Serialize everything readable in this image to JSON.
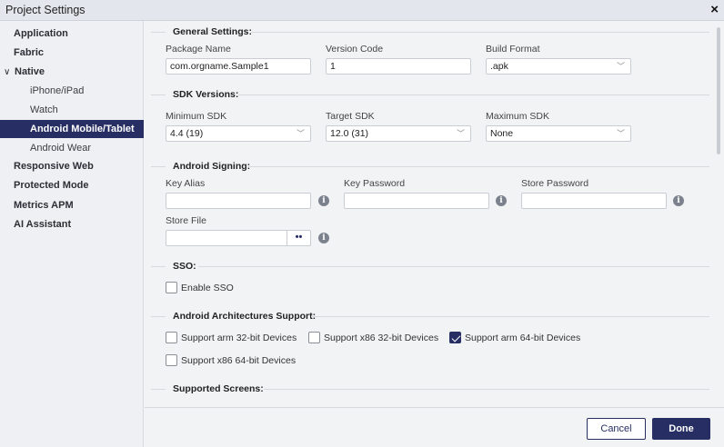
{
  "window": {
    "title": "Project Settings",
    "close_icon": "×"
  },
  "sidebar": {
    "items": [
      {
        "label": "Application"
      },
      {
        "label": "Fabric"
      },
      {
        "label": "Native",
        "chevron": "∨"
      },
      {
        "label": "iPhone/iPad"
      },
      {
        "label": "Watch"
      },
      {
        "label": "Android Mobile/Tablet"
      },
      {
        "label": "Android Wear"
      },
      {
        "label": "Responsive Web"
      },
      {
        "label": "Protected Mode"
      },
      {
        "label": "Metrics APM"
      },
      {
        "label": "AI Assistant"
      }
    ]
  },
  "general": {
    "title": "General Settings:",
    "package_name_label": "Package Name",
    "package_name_value": "com.orgname.Sample1",
    "version_code_label": "Version Code",
    "version_code_value": "1",
    "build_format_label": "Build Format",
    "build_format_value": ".apk"
  },
  "sdk": {
    "title": "SDK Versions:",
    "min_label": "Minimum SDK",
    "min_value": "4.4 (19)",
    "target_label": "Target SDK",
    "target_value": "12.0 (31)",
    "max_label": "Maximum SDK",
    "max_value": "None"
  },
  "signing": {
    "title": "Android Signing:",
    "key_alias_label": "Key Alias",
    "key_password_label": "Key Password",
    "store_password_label": "Store Password",
    "store_file_label": "Store File",
    "browse_label": "••",
    "info_glyph": "i"
  },
  "sso": {
    "title": "SSO:",
    "enable_label": "Enable SSO",
    "enable_checked": false
  },
  "arch": {
    "title": "Android Architectures Support:",
    "arm32_label": "Support arm 32-bit Devices",
    "x86_32_label": "Support x86 32-bit Devices",
    "arm64_label": "Support arm 64-bit Devices",
    "x86_64_label": "Support x86 64-bit Devices",
    "arm64_checked": true
  },
  "screens": {
    "title": "Supported Screens:"
  },
  "footer": {
    "cancel_label": "Cancel",
    "done_label": "Done"
  },
  "colors": {
    "accent": "#262e63",
    "sidebar_bg": "#eef0f3",
    "content_bg": "#f2f3f5"
  },
  "icons": {
    "close": "close-icon",
    "chevron": "chevron-down-icon",
    "info": "info-icon",
    "check": "check-icon"
  }
}
